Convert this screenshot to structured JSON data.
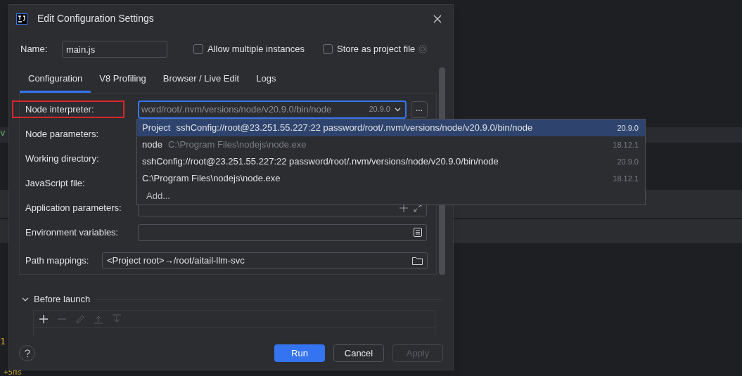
{
  "background_text": [
    {
      "text": "v",
      "kind": "green"
    },
    {
      "text": "1",
      "kind": "yellow"
    },
    {
      "text": "+5ms",
      "kind": "yellow"
    }
  ],
  "window": {
    "title": "Edit Configuration Settings"
  },
  "name_field": {
    "label": "Name:",
    "value": "main.js"
  },
  "options": [
    {
      "label": "Allow multiple instances",
      "checked": false
    },
    {
      "label": "Store as project file",
      "checked": false
    }
  ],
  "tabs": [
    {
      "label": "Configuration",
      "selected": true
    },
    {
      "label": "V8 Profiling",
      "selected": false
    },
    {
      "label": "Browser / Live Edit",
      "selected": false
    },
    {
      "label": "Logs",
      "selected": false
    }
  ],
  "fields": [
    {
      "label": "Node interpreter:",
      "kind": "combo",
      "highlighted": true,
      "value": "word/root/.nvm/versions/node/v20.9.0/bin/node",
      "version": "20.9.0",
      "button": "..."
    },
    {
      "label": "Node parameters:",
      "kind": "covered",
      "highlighted": false
    },
    {
      "label": "Working directory:",
      "kind": "covered",
      "highlighted": false
    },
    {
      "label": "JavaScript file:",
      "kind": "covered",
      "highlighted": false
    },
    {
      "label": "Application parameters:",
      "kind": "expandable",
      "highlighted": false
    },
    {
      "label": "Environment variables:",
      "kind": "document",
      "highlighted": false
    },
    {
      "label": "Path mappings:",
      "kind": "folder",
      "highlighted": false,
      "value": "<Project root>→/root/aitail-llm-svc"
    }
  ],
  "dropdown": {
    "items": [
      {
        "kind": "entry",
        "label": "Project",
        "path": "sshConfig://root@23.251.55.227:22 password/root/.nvm/versions/node/v20.9.0/bin/node",
        "path_dimmed": false,
        "version": "20.9.0",
        "selected": true
      },
      {
        "kind": "entry",
        "label": "node",
        "path": "C:\\Program Files\\nodejs\\node.exe",
        "path_dimmed": true,
        "version": "18.12.1",
        "selected": false
      },
      {
        "kind": "entry",
        "path": "sshConfig://root@23.251.55.227:22 password/root/.nvm/versions/node/v20.9.0/bin/node",
        "path_dimmed": false,
        "version": "20.9.0",
        "selected": false
      },
      {
        "kind": "entry",
        "path": "C:\\Program Files\\nodejs\\node.exe",
        "path_dimmed": false,
        "version": "18.12.1",
        "selected": false
      },
      {
        "kind": "action",
        "path": "Add...",
        "selected": false
      }
    ]
  },
  "before_launch": {
    "label": "Before launch",
    "expanded": true,
    "tools": [
      {
        "kind": "add",
        "disabled": false
      },
      {
        "kind": "remove",
        "disabled": true
      },
      {
        "kind": "edit",
        "disabled": true
      },
      {
        "kind": "up",
        "disabled": true
      },
      {
        "kind": "down",
        "disabled": true
      }
    ]
  },
  "buttons": [
    {
      "label": "Run",
      "kind": "primary",
      "disabled": false
    },
    {
      "label": "Cancel",
      "kind": "normal",
      "disabled": false
    },
    {
      "label": "Apply",
      "kind": "normal",
      "disabled": true
    }
  ]
}
